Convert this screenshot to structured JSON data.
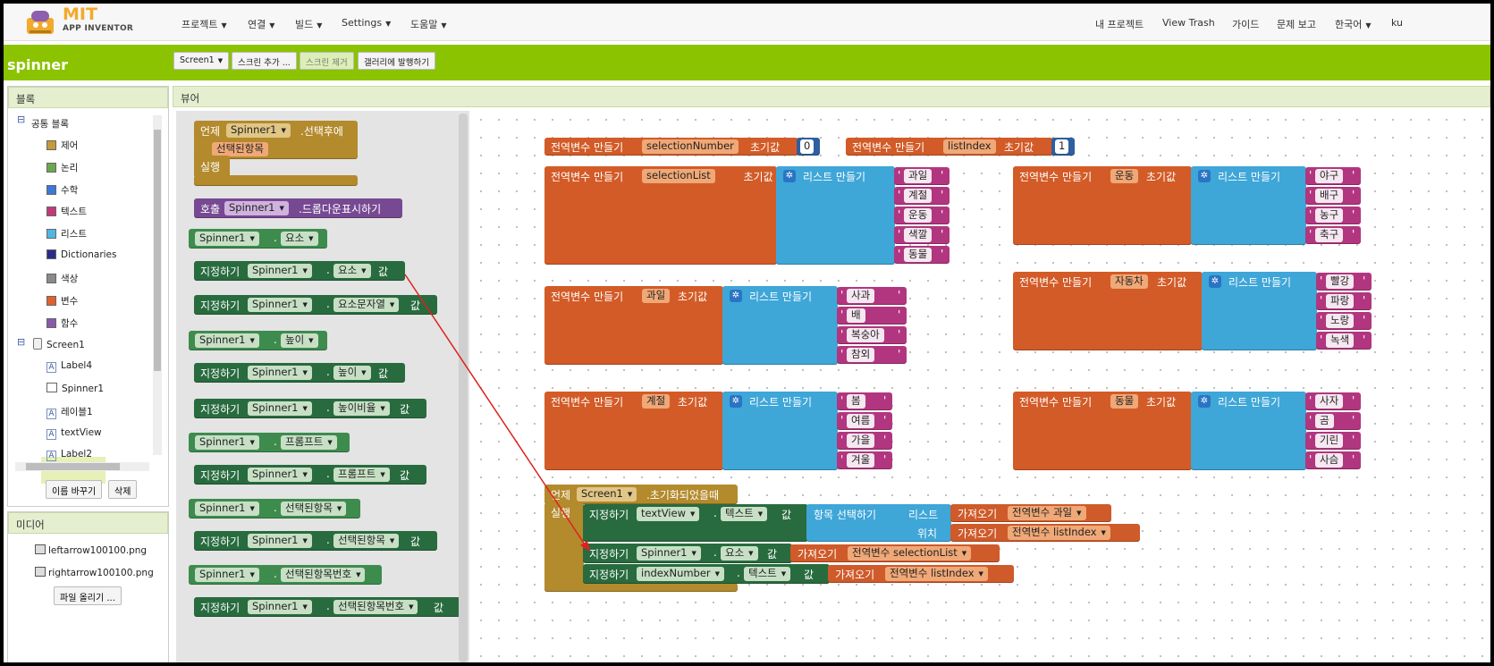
{
  "logo": {
    "line1": "MIT",
    "line2": "APP INVENTOR"
  },
  "menu_left": [
    {
      "label": "프로젝트"
    },
    {
      "label": "연결"
    },
    {
      "label": "빌드"
    },
    {
      "label": "Settings"
    },
    {
      "label": "도움말"
    }
  ],
  "menu_right": [
    {
      "label": "내 프로젝트"
    },
    {
      "label": "View Trash"
    },
    {
      "label": "가이드"
    },
    {
      "label": "문제 보고"
    },
    {
      "label": "한국어"
    },
    {
      "label": "ku"
    }
  ],
  "project_name": "spinner",
  "toolbar": {
    "screen": "Screen1",
    "add_screen": "스크린 추가 ...",
    "remove_screen": "스크린 제거",
    "publish": "갤러리에 발행하기"
  },
  "blocks_panel": {
    "title": "블록",
    "builtin": "공통 블록",
    "categories": [
      {
        "label": "제어",
        "color": "#c49a3a"
      },
      {
        "label": "논리",
        "color": "#6aa84f"
      },
      {
        "label": "수학",
        "color": "#3c78d8"
      },
      {
        "label": "텍스트",
        "color": "#c0397a"
      },
      {
        "label": "리스트",
        "color": "#4fb6e3"
      },
      {
        "label": "Dictionaries",
        "color": "#2b2b8a"
      },
      {
        "label": "색상",
        "color": "#8a8a8a"
      },
      {
        "label": "변수",
        "color": "#e0612e"
      },
      {
        "label": "함수",
        "color": "#8b5aa6"
      }
    ],
    "screen": "Screen1",
    "components": [
      "Label4",
      "Spinner1",
      "레이블1",
      "textView",
      "Label2"
    ],
    "rename": "이름 바꾸기",
    "delete": "삭제"
  },
  "media": {
    "title": "미디어",
    "files": [
      "leftarrow100100.png",
      "rightarrow100100.png"
    ],
    "upload": "파일 올리기 ..."
  },
  "viewer": {
    "title": "뷰어"
  },
  "drawer": {
    "event_when": "언제",
    "event_comp": "Spinner1",
    "event_name": ".선택후에",
    "event_param": "선택된항목",
    "event_do": "실행",
    "call_kw": "호출",
    "call_comp": "Spinner1",
    "call_name": ".드롭다운표시하기",
    "set_kw": "지정하기",
    "comp": "Spinner1",
    "dot": ".",
    "value_kw": "값",
    "props": [
      "요소",
      "요소문자열",
      "높이",
      "높이비율",
      "프롬프트",
      "선택된항목",
      "선택된항목번호"
    ]
  },
  "ws": {
    "global": "전역변수",
    "make": "만들기",
    "init": "초기값",
    "make_list": "리스트 만들기",
    "selectionNumber": {
      "name": "selectionNumber",
      "value": "0"
    },
    "listIndex": {
      "name": "listIndex",
      "value": "1"
    },
    "selectionList": {
      "name": "selectionList",
      "items": [
        "과일",
        "계절",
        "운동",
        "색깔",
        "동물"
      ]
    },
    "sports": {
      "name": "운동",
      "items": [
        "야구",
        "배구",
        "농구",
        "축구"
      ]
    },
    "fruit": {
      "name": "과일",
      "items": [
        "사과",
        "배",
        "복숭아",
        "참외"
      ]
    },
    "car": {
      "name": "자동차",
      "items": [
        "빨강",
        "파랑",
        "노랑",
        "녹색"
      ]
    },
    "season": {
      "name": "계절",
      "items": [
        "봄",
        "여름",
        "가을",
        "겨울"
      ]
    },
    "animal": {
      "name": "동물",
      "items": [
        "사자",
        "곰",
        "기린",
        "사슴"
      ]
    },
    "init_event": {
      "when": "언제",
      "comp": "Screen1",
      "name": ".초기화되었을때",
      "do": "실행"
    },
    "stmt1": {
      "set": "지정하기",
      "comp": "textView",
      "prop": "텍스트",
      "val": "값",
      "select": "항목 선택하기",
      "list_kw": "리스트",
      "index_kw": "위치",
      "get": "가져오기",
      "g1": "전역변수 과일",
      "g2": "전역변수 listIndex"
    },
    "stmt2": {
      "set": "지정하기",
      "comp": "Spinner1",
      "prop": "요소",
      "val": "값",
      "get": "가져오기",
      "g": "전역변수 selectionList"
    },
    "stmt3": {
      "set": "지정하기",
      "comp": "indexNumber",
      "prop": "텍스트",
      "val": "값",
      "get": "가져오기",
      "g": "전역변수 listIndex"
    }
  },
  "colors": {
    "green_bar": "#8bc300",
    "arrow": "#e02020"
  }
}
